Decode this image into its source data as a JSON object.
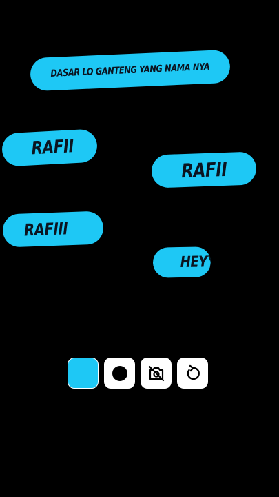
{
  "colors": {
    "background": "#000000",
    "caption_bg": "#1ec8f5",
    "caption_text": "#0b1420",
    "tool_bg": "#ffffff"
  },
  "captions": {
    "header": "DASAR LO  GANTENG  YANG NAMA NYA",
    "item_1": "RAFII",
    "item_2": "RAFII",
    "item_3": "RAFIII",
    "item_4": "HEYY"
  },
  "toolbar": {
    "items": [
      {
        "icon": "color-swatch",
        "selected_color": "#1ec8f5"
      },
      {
        "icon": "record-circle-icon"
      },
      {
        "icon": "camera-off-icon"
      },
      {
        "icon": "rotate-icon"
      }
    ]
  }
}
